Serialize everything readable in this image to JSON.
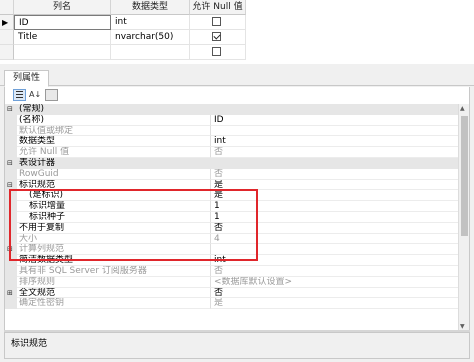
{
  "columns_grid": {
    "headers": [
      "列名",
      "数据类型",
      "允许 Null 值"
    ],
    "rows": [
      {
        "name": "ID",
        "type": "int",
        "allow_null": false,
        "key": true
      },
      {
        "name": "Title",
        "type": "nvarchar(50)",
        "allow_null": true
      },
      {
        "name": "",
        "type": "",
        "allow_null": false
      }
    ]
  },
  "tab": {
    "label": "列属性"
  },
  "toolbar": {
    "icons": [
      "categorized-icon",
      "alphabetical-icon",
      "property-pages-icon"
    ]
  },
  "properties": [
    {
      "kind": "cat",
      "name": "(常规)",
      "value": ""
    },
    {
      "kind": "prop",
      "name": "(名称)",
      "value": "ID"
    },
    {
      "kind": "prop",
      "name": "默认值或绑定",
      "value": "",
      "dim": true
    },
    {
      "kind": "prop",
      "name": "数据类型",
      "value": "int"
    },
    {
      "kind": "prop",
      "name": "允许 Null 值",
      "value": "否",
      "dim": true
    },
    {
      "kind": "cat",
      "name": "表设计器",
      "value": ""
    },
    {
      "kind": "prop",
      "name": "RowGuid",
      "value": "否",
      "dim": true
    },
    {
      "kind": "sub",
      "name": "标识规范",
      "value": "是",
      "expander": "⊟"
    },
    {
      "kind": "prop",
      "name": "(是标识)",
      "value": "是",
      "indent": true
    },
    {
      "kind": "prop",
      "name": "标识增量",
      "value": "1",
      "indent": true
    },
    {
      "kind": "prop",
      "name": "标识种子",
      "value": "1",
      "indent": true
    },
    {
      "kind": "prop",
      "name": "不用于复制",
      "value": "否"
    },
    {
      "kind": "prop",
      "name": "大小",
      "value": "4",
      "dim": true
    },
    {
      "kind": "sub",
      "name": "计算列规范",
      "value": "",
      "expander": "⊞",
      "dim": true
    },
    {
      "kind": "prop",
      "name": "简洁数据类型",
      "value": "int"
    },
    {
      "kind": "prop",
      "name": "具有非 SQL Server 订阅服务器",
      "value": "否",
      "dim": true
    },
    {
      "kind": "prop",
      "name": "排序规则",
      "value": "<数据库默认设置>",
      "dim": true
    },
    {
      "kind": "sub",
      "name": "全文规范",
      "value": "否",
      "expander": "⊞"
    },
    {
      "kind": "prop",
      "name": "确定性密钥",
      "value": "是",
      "dim": true
    }
  ],
  "description": {
    "title": "标识规范"
  },
  "colors": {
    "highlight_box": "#e0262b"
  }
}
